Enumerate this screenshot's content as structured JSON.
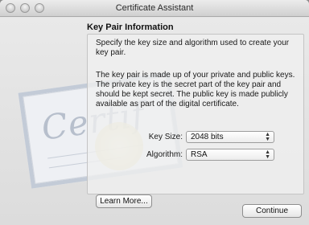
{
  "window": {
    "title": "Certificate Assistant"
  },
  "page": {
    "heading": "Key Pair Information",
    "intro": "Specify the key size and algorithm used to create your key pair.",
    "description": "The key pair is made up of your private and public keys. The private key is the secret part of the key pair and should be kept secret. The public key is made publicly available as part of the digital certificate."
  },
  "form": {
    "key_size_label": "Key Size:",
    "key_size_value": "2048 bits",
    "algorithm_label": "Algorithm:",
    "algorithm_value": "RSA"
  },
  "buttons": {
    "learn_more": "Learn More...",
    "continue": "Continue"
  },
  "decoration": {
    "script_text": "Certif"
  },
  "colors": {
    "window_bg": "#e3e3e3",
    "panel_border": "#c4c4c4"
  }
}
